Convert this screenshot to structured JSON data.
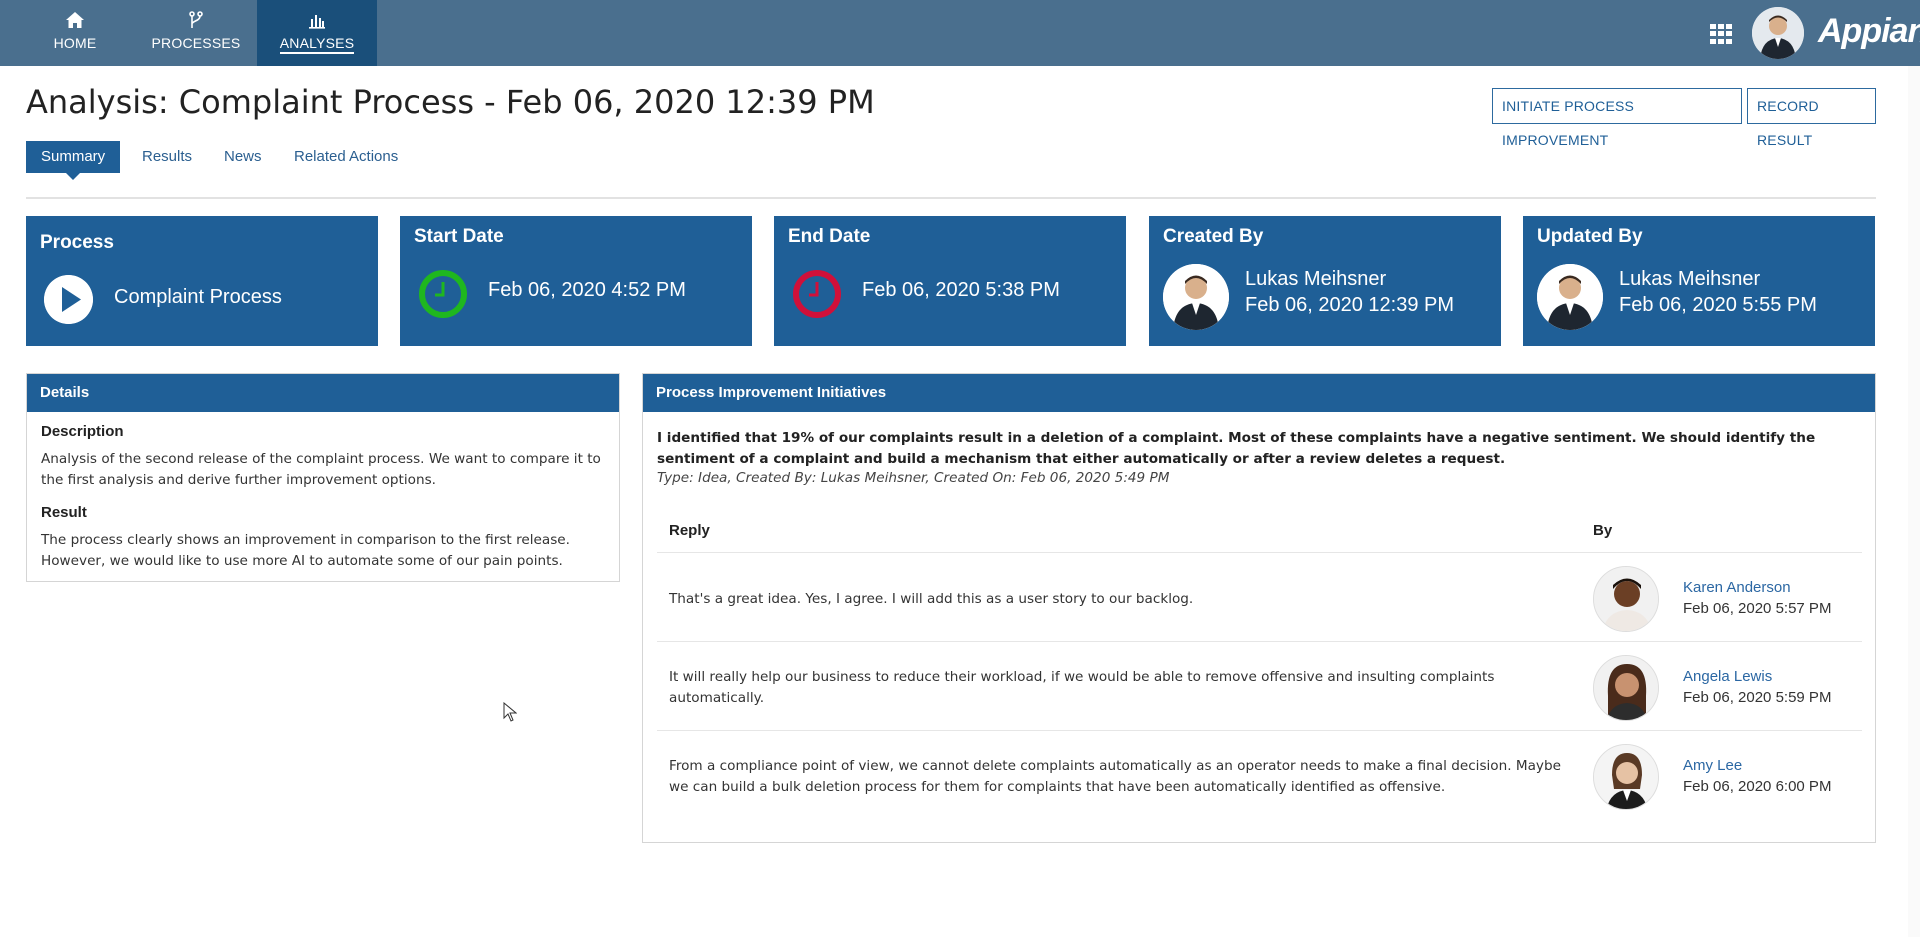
{
  "nav": {
    "tabs": [
      {
        "label": "HOME",
        "icon": "home-icon"
      },
      {
        "label": "PROCESSES",
        "icon": "branch-icon"
      },
      {
        "label": "ANALYSES",
        "icon": "bar-chart-icon",
        "active": true
      }
    ],
    "logo": "Appian",
    "apps_icon": "apps-grid-icon"
  },
  "page": {
    "title": "Analysis: Complaint Process - Feb 06, 2020 12:39 PM",
    "actions": {
      "initiate": "INITIATE PROCESS IMPROVEMENT",
      "record": "RECORD RESULT"
    },
    "subtabs": [
      "Summary",
      "Results",
      "News",
      "Related Actions"
    ]
  },
  "cards": {
    "process": {
      "title": "Process",
      "value": "Complaint Process",
      "icon": "play-icon"
    },
    "start": {
      "title": "Start Date",
      "value": "Feb 06, 2020 4:52 PM",
      "icon": "clock-icon",
      "color": "#1fb71f"
    },
    "end": {
      "title": "End Date",
      "value": "Feb 06, 2020 5:38 PM",
      "icon": "clock-icon",
      "color": "#d0103a"
    },
    "created": {
      "title": "Created By",
      "name": "Lukas Meihsner",
      "date": "Feb 06, 2020 12:39 PM"
    },
    "updated": {
      "title": "Updated By",
      "name": "Lukas Meihsner",
      "date": "Feb 06, 2020 5:55 PM"
    }
  },
  "details": {
    "header": "Details",
    "description_label": "Description",
    "description": "Analysis of the second release of the complaint process. We want to compare it to the first analysis and derive further improvement options.",
    "result_label": "Result",
    "result": "The process clearly shows an improvement in comparison to the first release. However, we would like to use more AI to automate some of our pain points."
  },
  "initiatives": {
    "header": "Process Improvement Initiatives",
    "idea": "I identified that 19% of our complaints result in a deletion of a complaint. Most of these complaints have a negative sentiment. We should identify the sentiment of a complaint and build a mechanism that either automatically or after a review deletes a request.",
    "meta": "Type: Idea, Created By: Lukas Meihsner, Created On: Feb 06, 2020 5:49 PM",
    "columns": {
      "reply": "Reply",
      "by": "By"
    },
    "replies": [
      {
        "text": "That's a great idea. Yes, I agree. I will add this as a user story to our backlog.",
        "name": "Karen Anderson",
        "date": "Feb 06, 2020 5:57 PM"
      },
      {
        "text": "It will really help our business to reduce their workload, if we would be able to remove offensive and insulting complaints automatically.",
        "name": "Angela Lewis",
        "date": "Feb 06, 2020 5:59 PM"
      },
      {
        "text": "From a compliance point of view, we cannot delete complaints automatically as an operator needs to make a final decision. Maybe we can build a bulk deletion process for them for complaints that have been automatically identified as offensive.",
        "name": "Amy Lee",
        "date": "Feb 06, 2020 6:00 PM"
      }
    ]
  },
  "colors": {
    "topbar": "#4a6f8e",
    "active_tab": "#1a4f7a",
    "accent": "#1f5f97",
    "link": "#2b67a3"
  }
}
